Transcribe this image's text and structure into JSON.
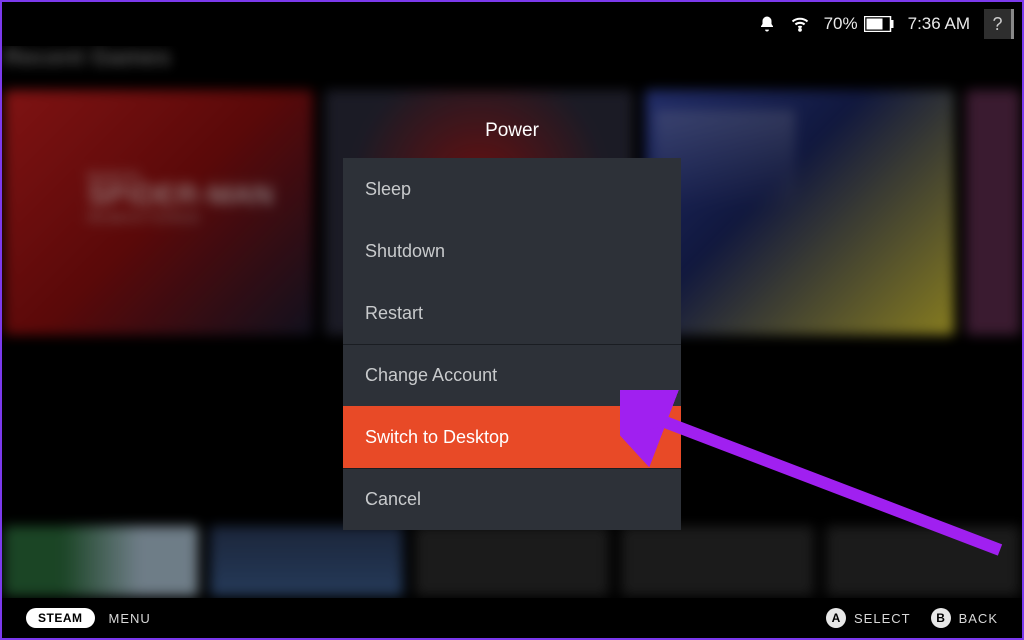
{
  "topbar": {
    "battery_percent": "70%",
    "clock": "7:36 AM",
    "help_glyph": "?"
  },
  "background": {
    "section_title": "Recent Games",
    "game1": {
      "marvel": "MARVEL",
      "title": "SPIDER-MAN",
      "sub": "REMASTERED"
    }
  },
  "power": {
    "title": "Power",
    "items": [
      {
        "label": "Sleep",
        "selected": false
      },
      {
        "label": "Shutdown",
        "selected": false
      },
      {
        "label": "Restart",
        "selected": false
      },
      {
        "label": "Change Account",
        "selected": false,
        "sep": true
      },
      {
        "label": "Switch to Desktop",
        "selected": true,
        "sep": true
      },
      {
        "label": "Cancel",
        "selected": false,
        "sep": true
      }
    ]
  },
  "footer": {
    "steam": "STEAM",
    "menu": "MENU",
    "hints": [
      {
        "btn": "A",
        "label": "SELECT"
      },
      {
        "btn": "B",
        "label": "BACK"
      }
    ]
  },
  "annotation": {
    "color": "#a020f0"
  }
}
